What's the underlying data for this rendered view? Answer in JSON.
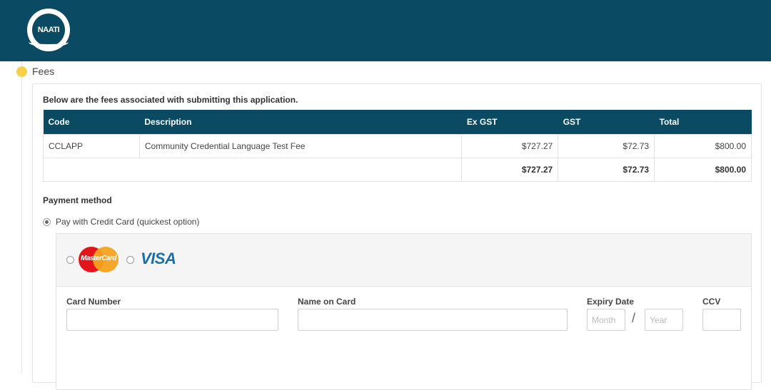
{
  "header": {
    "logo_text": "NAATI"
  },
  "step": {
    "title": "Fees"
  },
  "fees": {
    "intro": "Below are the fees associated with submitting this application.",
    "columns": [
      "Code",
      "Description",
      "Ex GST",
      "GST",
      "Total"
    ],
    "rows": [
      [
        "CCLAPP",
        "Community Credential Language Test Fee",
        "$727.27",
        "$72.73",
        "$800.00"
      ]
    ],
    "totals": [
      "",
      "",
      "$727.27",
      "$72.73",
      "$800.00"
    ]
  },
  "payment": {
    "title": "Payment method",
    "option_label": "Pay with Credit Card (quickest option)",
    "card_brands": [
      "MasterCard",
      "VISA"
    ],
    "fields": {
      "card_number_label": "Card Number",
      "name_label": "Name on Card",
      "expiry_label": "Expiry Date",
      "expiry_separator": "/",
      "ccv_label": "CCV",
      "expiry_month_placeholder": "Month",
      "expiry_year_placeholder": "Year"
    }
  },
  "colors": {
    "header": "#0a4a63",
    "step_dot": "#f7d04a",
    "visa": "#1a6fa8"
  }
}
